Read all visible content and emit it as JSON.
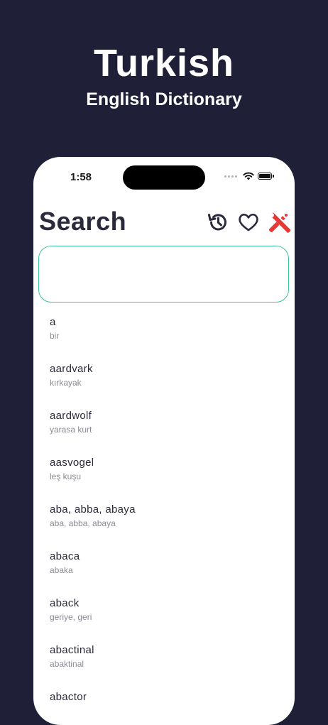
{
  "promo": {
    "title": "Turkish",
    "subtitle": "English Dictionary"
  },
  "status_bar": {
    "time": "1:58",
    "icons": [
      "signal-dots-icon",
      "wifi-icon",
      "battery-icon"
    ]
  },
  "header": {
    "title": "Search",
    "icons": [
      "history-icon",
      "heart-icon",
      "tools-icon"
    ]
  },
  "search": {
    "value": "",
    "placeholder": ""
  },
  "words": [
    {
      "term": "a",
      "translation": "bir"
    },
    {
      "term": "aardvark",
      "translation": "kırkayak"
    },
    {
      "term": "aardwolf",
      "translation": "yarasa kurt"
    },
    {
      "term": "aasvogel",
      "translation": "leş kuşu"
    },
    {
      "term": "aba, abba, abaya",
      "translation": "aba, abba, abaya"
    },
    {
      "term": "abaca",
      "translation": "abaka"
    },
    {
      "term": "aback",
      "translation": "geriye, geri"
    },
    {
      "term": "abactinal",
      "translation": "abaktinal"
    },
    {
      "term": "abactor",
      "translation": ""
    }
  ],
  "colors": {
    "background": "#1f1f37",
    "accent_green": "#3cc48f",
    "tools_red": "#e53935"
  }
}
